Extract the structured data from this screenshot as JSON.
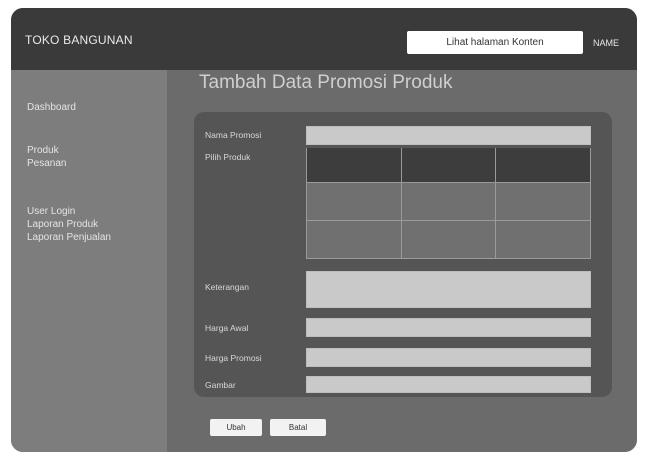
{
  "header": {
    "brand": "TOKO BANGUNAN",
    "view_store_button": "Lihat halaman Konten",
    "user_name": "NAME"
  },
  "sidebar": {
    "items": [
      {
        "label": "Dashboard"
      },
      {
        "label": "Produk"
      },
      {
        "label": "Pesanan"
      },
      {
        "label": "User Login"
      },
      {
        "label": "Laporan Produk"
      },
      {
        "label": "Laporan Penjualan"
      }
    ]
  },
  "main": {
    "title": "Tambah Data Promosi Produk",
    "form": {
      "nama_promosi_label": "Nama Promosi",
      "pilih_produk_label": "Pilih Produk",
      "keterangan_label": "Keterangan",
      "harga_awal_label": "Harga Awal",
      "harga_promosi_label": "Harga Promosi",
      "gambar_label": "Gambar"
    },
    "buttons": {
      "save": "Ubah",
      "cancel": "Batal"
    }
  },
  "colors": {
    "topbar": "#3a3a3a",
    "frame": "#6b6b6b",
    "sidebar": "#7d7d7d",
    "panel": "#555555",
    "input": "#c9c9c9"
  }
}
